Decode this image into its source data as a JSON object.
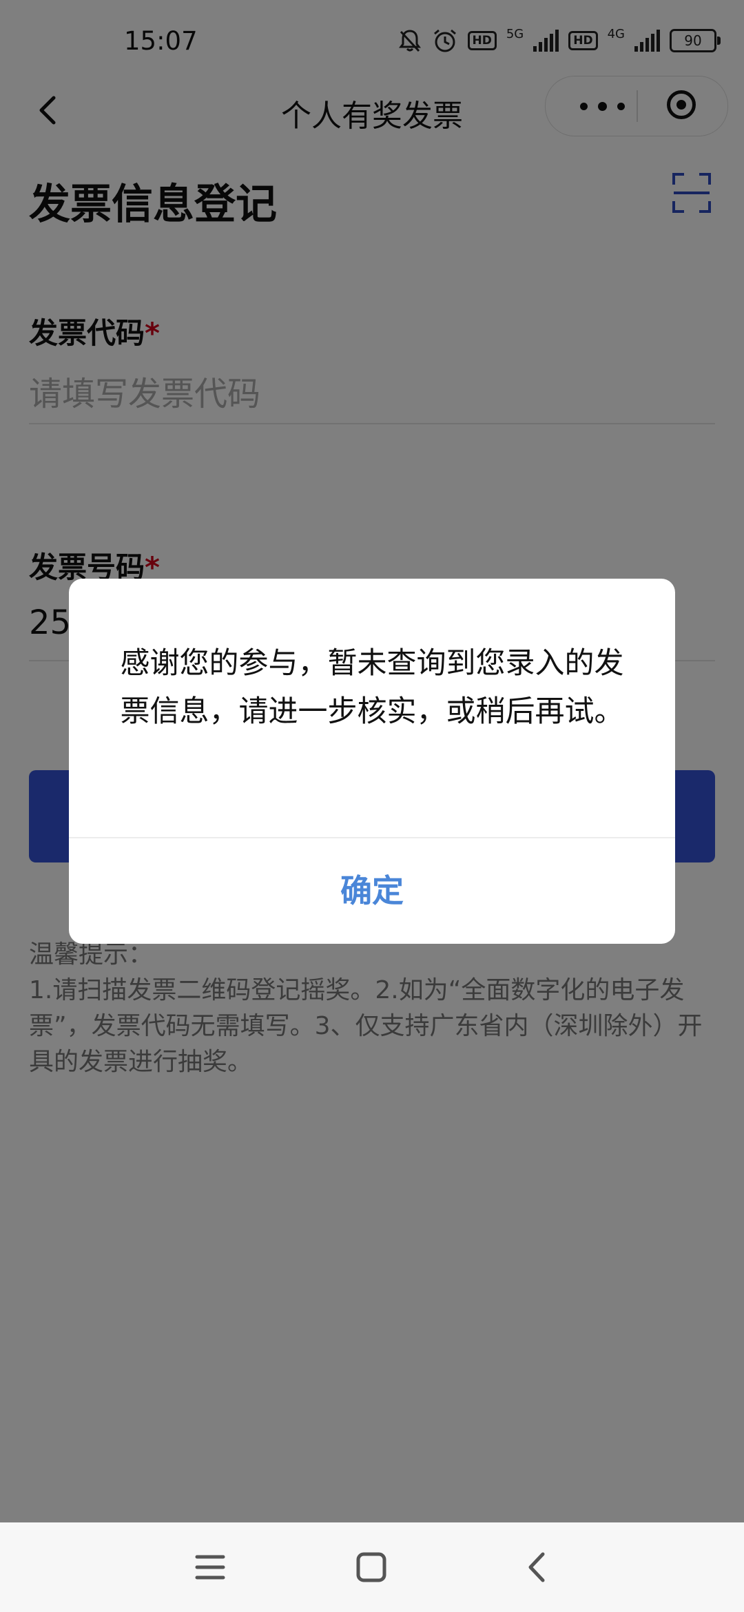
{
  "status_bar": {
    "time": "15:07",
    "battery": "90",
    "hd1": "HD",
    "net1": "5G",
    "hd2": "HD",
    "net2": "4G"
  },
  "nav": {
    "title": "个人有奖发票"
  },
  "page": {
    "title": "发票信息登记"
  },
  "fields": {
    "code": {
      "label": "发票代码",
      "required": "*",
      "placeholder": "请填写发票代码"
    },
    "number": {
      "label": "发票号码",
      "required": "*",
      "value": "25"
    }
  },
  "tips": {
    "heading": "温馨提示：",
    "body": "1.请扫描发票二维码登记摇奖。2.如为“全面数字化的电子发票”，发票代码无需填写。3、仅支持广东省内（深圳除外）开具的发票进行抽奖。"
  },
  "dialog": {
    "message": "感谢您的参与，暂未查询到您录入的发票信息，请进一步核实，或稍后再试。",
    "confirm": "确定"
  },
  "colors": {
    "primary": "#3552d6",
    "link": "#4a86d8",
    "required": "#d0021b"
  },
  "icons": [
    "back-icon",
    "more-icon",
    "close-mini-program-icon",
    "scan-icon",
    "menu-icon",
    "home-icon",
    "back-nav-icon"
  ]
}
